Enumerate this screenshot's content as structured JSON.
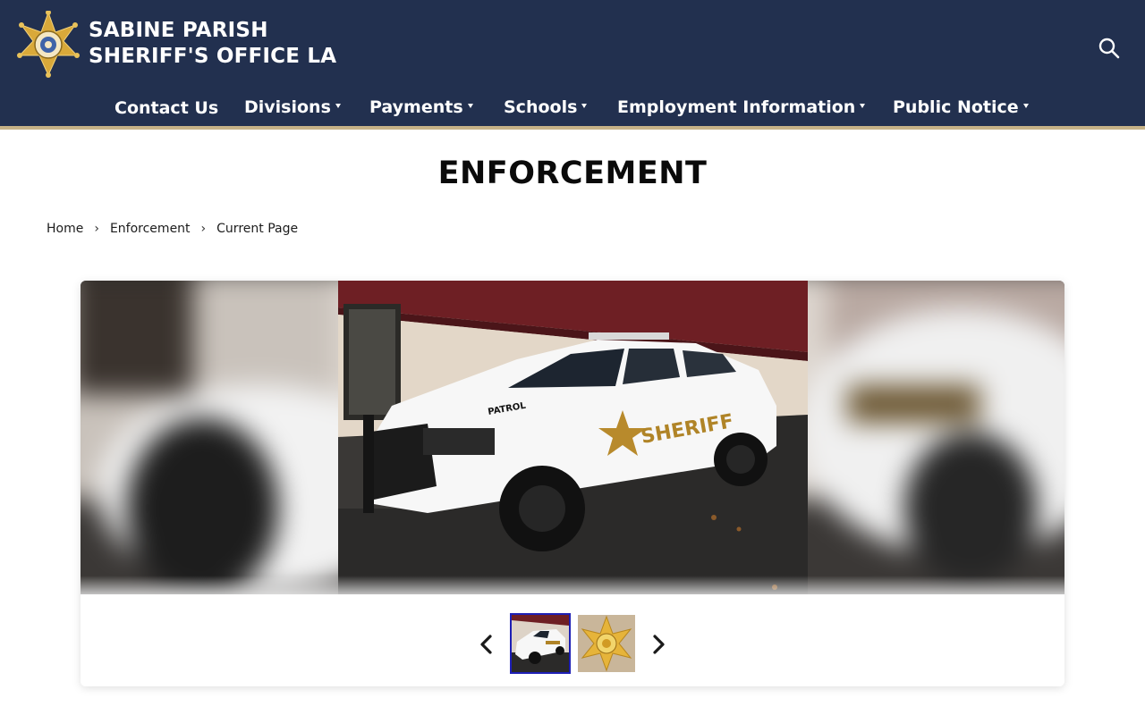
{
  "site": {
    "title_line1": "SABINE PARISH",
    "title_line2": "SHERIFF'S OFFICE LA",
    "logo": "sheriff-star-badge",
    "search_icon": "search-icon"
  },
  "nav": {
    "items": [
      {
        "label": "Contact Us",
        "dropdown": false
      },
      {
        "label": "Divisions",
        "dropdown": true
      },
      {
        "label": "Payments",
        "dropdown": true
      },
      {
        "label": "Schools",
        "dropdown": true
      },
      {
        "label": "Employment Information",
        "dropdown": true
      },
      {
        "label": "Public Notice",
        "dropdown": true
      }
    ]
  },
  "page": {
    "title": "ENFORCEMENT"
  },
  "breadcrumb": {
    "items": [
      "Home",
      "Enforcement",
      "Current Page"
    ],
    "separator": "›"
  },
  "gallery": {
    "main_image": "sheriff-patrol-suv",
    "vehicle_text_patrol": "PATROL",
    "vehicle_text_sheriff": "SHERIFF",
    "thumbnails": [
      {
        "image": "patrol-suv-thumbnail",
        "active": true
      },
      {
        "image": "sheriff-star-badge-thumbnail",
        "active": false
      }
    ],
    "prev_icon": "chevron-left-icon",
    "next_icon": "chevron-right-icon"
  },
  "colors": {
    "header_bg": "#22304f",
    "header_stripe": "#c6b287",
    "active_thumb_border": "#1e1fb5",
    "badge_gold": "#d9a93a"
  }
}
